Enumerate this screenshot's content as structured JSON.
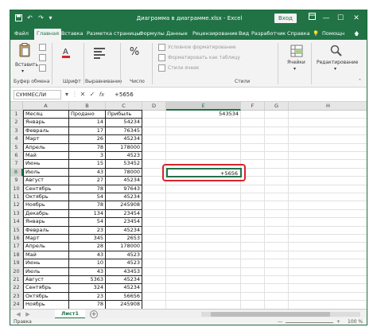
{
  "titlebar": {
    "title": "Диаграмма в диаграмме.xlsx - Excel",
    "login": "Вход",
    "minimize": "—",
    "maximize": "☐",
    "close": "✕"
  },
  "tabs": [
    "Файл",
    "Главная",
    "Вставка",
    "Разметка страницы",
    "Формулы",
    "Данные",
    "Рецензирование",
    "Вид",
    "Разработчик",
    "Справка"
  ],
  "tabs_right": {
    "light": "💡",
    "help": "Помощн",
    "share": "🡅"
  },
  "ribbon": {
    "paste": "Вставить",
    "clipboard": "Буфер обмена",
    "font": "Шрифт",
    "alignment": "Выравнивание",
    "number": "Число",
    "cond_format": "Условное форматирование",
    "format_table": "Форматировать как таблицу",
    "cell_styles": "Стили ячеек",
    "styles": "Стили",
    "cells_btn": "Ячейки",
    "cells_label": "",
    "editing": "Редактирование",
    "percent": "%"
  },
  "formula_bar": {
    "name_box": "СУММЕСЛИ",
    "cancel": "✕",
    "enter": "✓",
    "fx": "fx",
    "value": "+5656"
  },
  "columns": [
    "A",
    "B",
    "C",
    "D",
    "E",
    "F",
    "G",
    "H"
  ],
  "selected_column": "E",
  "table": {
    "header": [
      "Месяц",
      "Продано",
      "Прибыль"
    ],
    "rows": [
      [
        "Январь",
        "14",
        "54234"
      ],
      [
        "Февраль",
        "17",
        "76345"
      ],
      [
        "Март",
        "26",
        "45234"
      ],
      [
        "Апрель",
        "78",
        "178000"
      ],
      [
        "Май",
        "3",
        "4523"
      ],
      [
        "Июнь",
        "15",
        "53452"
      ],
      [
        "Июль",
        "43",
        "78000"
      ],
      [
        "Август",
        "27",
        "45234"
      ],
      [
        "Сентябрь",
        "78",
        "97643"
      ],
      [
        "Октябрь",
        "54",
        "45234"
      ],
      [
        "Ноябрь",
        "78",
        "245908"
      ],
      [
        "Декабрь",
        "134",
        "23454"
      ],
      [
        "Январь",
        "54",
        "23454"
      ],
      [
        "Февраль",
        "23",
        "45234"
      ],
      [
        "Март",
        "345",
        "2653"
      ],
      [
        "Апрель",
        "28",
        "178000"
      ],
      [
        "Май",
        "43",
        "4523"
      ],
      [
        "Июнь",
        "10",
        "4523"
      ],
      [
        "Июль",
        "43",
        "43453"
      ],
      [
        "Август",
        "5363",
        "45234"
      ],
      [
        "Сентябрь",
        "324",
        "45234"
      ],
      [
        "Октябрь",
        "23",
        "56656"
      ],
      [
        "Ноябрь",
        "78",
        "245908"
      ],
      [
        "Декабрь",
        "134",
        "23454"
      ]
    ]
  },
  "row_numbers": [
    "1",
    "2",
    "3",
    "4",
    "5",
    "6",
    "7",
    "8",
    "9",
    "10",
    "11",
    "12",
    "13",
    "14",
    "15",
    "16",
    "17",
    "18",
    "19",
    "20",
    "21",
    "22",
    "23",
    "24",
    "25"
  ],
  "e1_value": "543534",
  "active_cell": {
    "ref": "E8",
    "value": "+5656"
  },
  "sheet": {
    "name": "Лист1",
    "add": "+",
    "nav_prev": "◀",
    "nav_next": "▶"
  },
  "status": {
    "mode": "Правка",
    "zoom_minus": "—",
    "zoom_plus": "+",
    "zoom": "100 %"
  },
  "colors": {
    "excel_green": "#217346",
    "highlight_red": "#d9232b"
  }
}
